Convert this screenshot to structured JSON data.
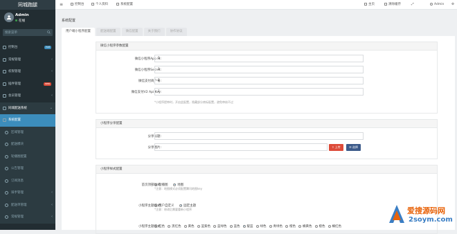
{
  "sidebar": {
    "logo": "同城跑腿",
    "user_name": "Admin",
    "user_status": "在线",
    "search_placeholder": "搜索菜单",
    "items": [
      {
        "label": "控制台",
        "badge": "hot",
        "badge_color": "#3c8dbc",
        "type": "item"
      },
      {
        "label": "常规管理",
        "chevron": "‹",
        "type": "item"
      },
      {
        "label": "权限管理",
        "chevron": "‹",
        "type": "item"
      },
      {
        "label": "插件管理",
        "badge": "new",
        "badge_color": "#dd4b39",
        "type": "item"
      },
      {
        "label": "会员管理",
        "chevron": "‹",
        "type": "item"
      },
      {
        "label": "同城配送系统",
        "chevron": "⌄",
        "type": "group"
      },
      {
        "label": "系统配置",
        "type": "active"
      },
      {
        "label": "区域管理",
        "type": "sub"
      },
      {
        "label": "配送模块",
        "type": "sub"
      },
      {
        "label": "轮播图配置",
        "type": "sub"
      },
      {
        "label": "公告管理",
        "type": "sub"
      },
      {
        "label": "订阅消息",
        "type": "sub"
      },
      {
        "label": "骑手管理",
        "chevron": "‹",
        "type": "sub"
      },
      {
        "label": "配送单管理",
        "chevron": "‹",
        "type": "sub"
      },
      {
        "label": "常规管理",
        "chevron": "‹",
        "type": "sub"
      }
    ]
  },
  "topbar": {
    "menu_icon": "≡",
    "links": [
      "控制台",
      "个人资料",
      "系统配置"
    ],
    "home": "主页",
    "clear_cache": "清除缓存",
    "admin": "Admin"
  },
  "page": {
    "title": "系统配置",
    "tabs": [
      "用户端小程序配置",
      "配送端配置",
      "微信配置",
      "关于我们",
      "协作协议"
    ]
  },
  "panels": {
    "wechat": {
      "header": "微信小程序参数配置",
      "rows": [
        {
          "label": "微信小程序App Id:",
          "value": "1"
        },
        {
          "label": "微信小程序Secret:",
          "value": "1"
        },
        {
          "label": "微信支付商户号:",
          "value": "1"
        },
        {
          "label": "微信支付V2 Api Key:",
          "value": "1"
        }
      ],
      "hint": "*小程序提审时，开启此配置，隐藏部分商标配置，避免审核不过"
    },
    "share": {
      "header": "小程序分享配置",
      "title_label": "分享标题:",
      "title_value": "",
      "image_label": "分享图片:",
      "image_value": "",
      "upload_label": "上传",
      "upload_color": "#dd4b39",
      "select_label": "选择",
      "select_color": "#3c5a8a"
    },
    "style": {
      "header": "小程序样式配置",
      "home_label": "首页顶部样式:",
      "home_options": [
        "轮播图",
        "地图"
      ],
      "home_hint": "*注意：地图模式必须配置腾讯地图key",
      "theme_label": "小程序主题模式:",
      "theme_options": [
        "用户自定义",
        "固定主题"
      ],
      "theme_hint": "*注意：修改后需要重新小程序",
      "color_label": "小程序主题模式:",
      "color_options": [
        "红色",
        "黑红色",
        "黄色",
        "蓝紫色",
        "蓝绿色",
        "蓝色",
        "靛蓝",
        "绿色",
        "青绿色",
        "橙色",
        "橘黄色",
        "橙色",
        "橘红色"
      ]
    }
  },
  "watermark": {
    "line1": "爱搜源码网",
    "line2": "2soym.com",
    "accent": "#e8630a",
    "secondary": "#3a7ec4"
  }
}
